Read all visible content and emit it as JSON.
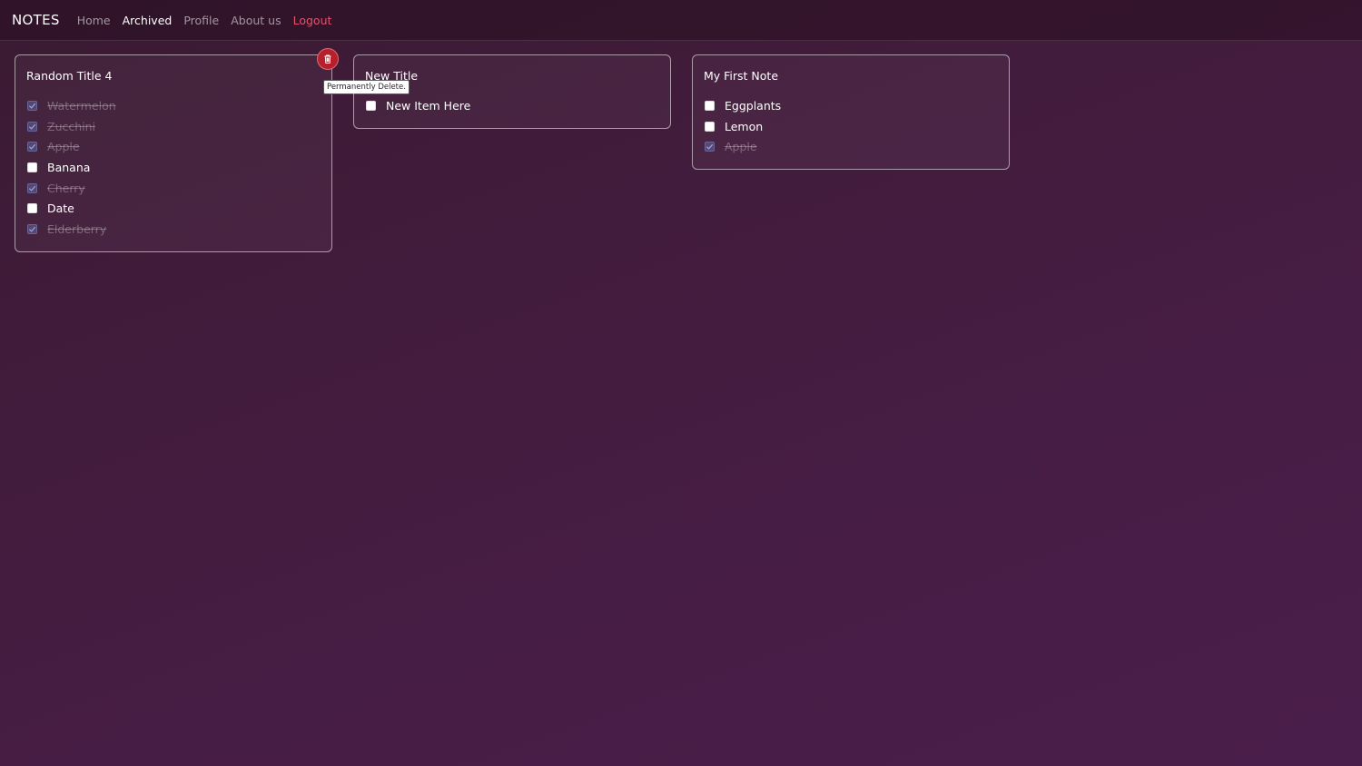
{
  "navbar": {
    "brand": "NOTES",
    "links": [
      {
        "label": "Home"
      },
      {
        "label": "Archived"
      },
      {
        "label": "Profile"
      },
      {
        "label": "About us"
      },
      {
        "label": "Logout"
      }
    ],
    "active": "Archived"
  },
  "notes": [
    {
      "title": "Random Title 4",
      "items": [
        {
          "label": "Watermelon",
          "checked": true
        },
        {
          "label": "Zucchini",
          "checked": true
        },
        {
          "label": "Apple",
          "checked": true
        },
        {
          "label": "Banana",
          "checked": false
        },
        {
          "label": "Cherry",
          "checked": true
        },
        {
          "label": "Date",
          "checked": false
        },
        {
          "label": "Elderberry",
          "checked": true
        }
      ]
    },
    {
      "title": "New Title",
      "items": [
        {
          "label": "New Item Here",
          "checked": false
        }
      ]
    },
    {
      "title": "My First Note",
      "items": [
        {
          "label": "Eggplants",
          "checked": false
        },
        {
          "label": "Lemon",
          "checked": false
        },
        {
          "label": "Apple",
          "checked": true
        }
      ]
    }
  ],
  "delete_button": {
    "icon": "trash-icon",
    "tooltip": "Permanently Delete."
  },
  "colors": {
    "accent_logout": "#e0556c",
    "delete_red": "#b5202c"
  }
}
